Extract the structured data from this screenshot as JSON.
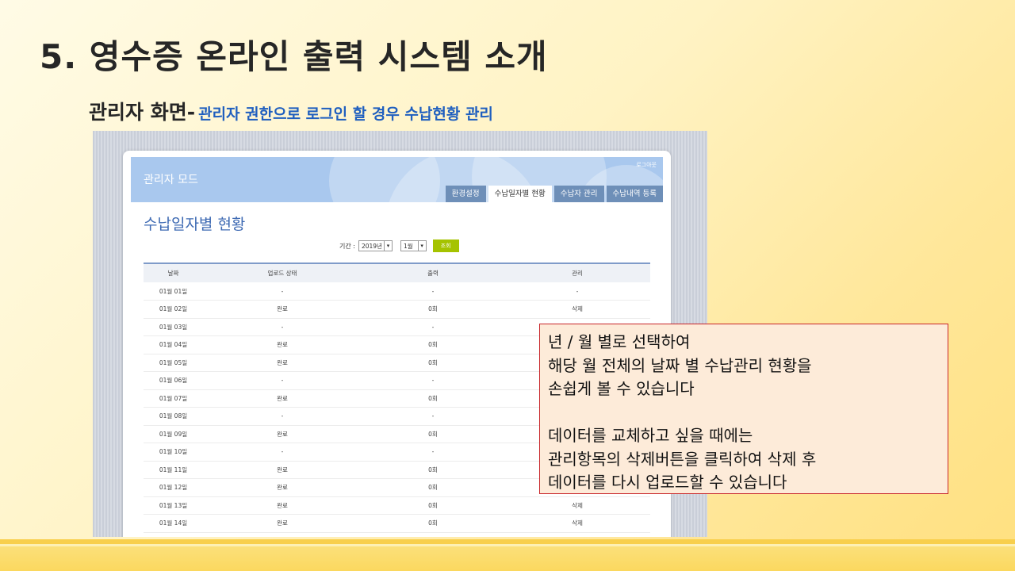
{
  "slide": {
    "title": "5. 영수증 온라인 출력 시스템 소개",
    "subtitle": "관리자 화면-",
    "subtitle_desc": "관리자 권한으로 로그인 할 경우 수납현황 관리"
  },
  "admin": {
    "mode_title": "관리자 모드",
    "logout": "로그아웃",
    "tabs": [
      {
        "label": "환경설정",
        "active": false
      },
      {
        "label": "수납일자별 현황",
        "active": true
      },
      {
        "label": "수납자 관리",
        "active": false
      },
      {
        "label": "수납내역 등록",
        "active": false
      }
    ],
    "page_heading": "수납일자별 현황",
    "filter": {
      "label": "기간 :",
      "year": "2019년",
      "month": "1월",
      "search_button": "조회"
    },
    "table": {
      "headers": [
        "날짜",
        "업로드 상태",
        "출력",
        "관리"
      ],
      "rows": [
        [
          "01월 01일",
          "-",
          "-",
          "-"
        ],
        [
          "01월 02일",
          "완료",
          "0회",
          "삭제"
        ],
        [
          "01월 03일",
          "-",
          "-",
          ""
        ],
        [
          "01월 04일",
          "완료",
          "0회",
          ""
        ],
        [
          "01월 05일",
          "완료",
          "0회",
          ""
        ],
        [
          "01월 06일",
          "-",
          "-",
          ""
        ],
        [
          "01월 07일",
          "완료",
          "0회",
          ""
        ],
        [
          "01월 08일",
          "-",
          "-",
          ""
        ],
        [
          "01월 09일",
          "완료",
          "0회",
          ""
        ],
        [
          "01월 10일",
          "-",
          "-",
          ""
        ],
        [
          "01월 11일",
          "완료",
          "0회",
          ""
        ],
        [
          "01월 12일",
          "완료",
          "0회",
          ""
        ],
        [
          "01월 13일",
          "완료",
          "0회",
          "삭제"
        ],
        [
          "01월 14일",
          "완료",
          "0회",
          "삭제"
        ]
      ]
    }
  },
  "note": {
    "lines_a": [
      "년 / 월 별로 선택하여",
      "해당 월 전체의 날짜 별 수납관리 현황을",
      "손쉽게 볼 수 있습니다"
    ],
    "lines_b": [
      "데이터를 교체하고 싶을 때에는",
      "관리항목의 삭제버튼을 클릭하여 삭제 후",
      "데이터를 다시 업로드할 수 있습니다"
    ]
  },
  "colors": {
    "banner": "#a9c8ee",
    "tab": "#6e8fb8",
    "heading": "#3e6ab3",
    "search_button": "#a5c300",
    "note_bg": "#fdebd9",
    "note_border": "#c8262a"
  }
}
